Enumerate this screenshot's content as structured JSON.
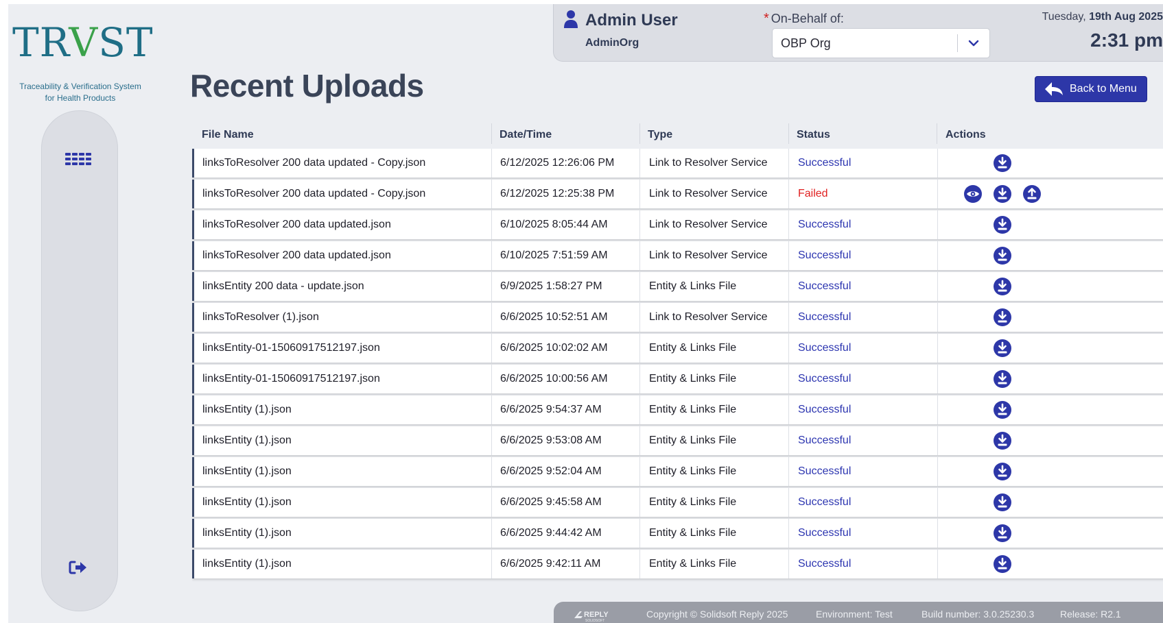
{
  "logo": {
    "name": "TRVST",
    "part1": "TR",
    "part2": "V",
    "part3": "ST",
    "tagline_line1": "Traceability & Verification System",
    "tagline_line2": "for Health Products"
  },
  "header": {
    "user_name": "Admin User",
    "user_org": "AdminOrg",
    "on_behalf_required": "*",
    "on_behalf_label": "On-Behalf of:",
    "on_behalf_value": "OBP Org",
    "date_day": "Tuesday,",
    "date_bold": "19th Aug 2025",
    "time": "2:31 pm"
  },
  "page": {
    "title": "Recent Uploads",
    "back_button": "Back to Menu"
  },
  "table": {
    "columns": [
      "File Name",
      "Date/Time",
      "Type",
      "Status",
      "Actions"
    ],
    "rows": [
      {
        "file": "linksToResolver 200 data updated - Copy.json",
        "datetime": "6/12/2025 12:26:06 PM",
        "type": "Link to Resolver Service",
        "status": "Successful",
        "actions": [
          "download"
        ]
      },
      {
        "file": "linksToResolver 200 data updated - Copy.json",
        "datetime": "6/12/2025 12:25:38 PM",
        "type": "Link to Resolver Service",
        "status": "Failed",
        "actions": [
          "view",
          "download",
          "upload"
        ]
      },
      {
        "file": "linksToResolver 200 data updated.json",
        "datetime": "6/10/2025 8:05:44 AM",
        "type": "Link to Resolver Service",
        "status": "Successful",
        "actions": [
          "download"
        ]
      },
      {
        "file": "linksToResolver 200 data updated.json",
        "datetime": "6/10/2025 7:51:59 AM",
        "type": "Link to Resolver Service",
        "status": "Successful",
        "actions": [
          "download"
        ]
      },
      {
        "file": "linksEntity 200 data - update.json",
        "datetime": "6/9/2025 1:58:27 PM",
        "type": "Entity & Links File",
        "status": "Successful",
        "actions": [
          "download"
        ]
      },
      {
        "file": "linksToResolver (1).json",
        "datetime": "6/6/2025 10:52:51 AM",
        "type": "Link to Resolver Service",
        "status": "Successful",
        "actions": [
          "download"
        ]
      },
      {
        "file": "linksEntity-01-15060917512197.json",
        "datetime": "6/6/2025 10:02:02 AM",
        "type": "Entity & Links File",
        "status": "Successful",
        "actions": [
          "download"
        ]
      },
      {
        "file": "linksEntity-01-15060917512197.json",
        "datetime": "6/6/2025 10:00:56 AM",
        "type": "Entity & Links File",
        "status": "Successful",
        "actions": [
          "download"
        ]
      },
      {
        "file": "linksEntity (1).json",
        "datetime": "6/6/2025 9:54:37 AM",
        "type": "Entity & Links File",
        "status": "Successful",
        "actions": [
          "download"
        ]
      },
      {
        "file": "linksEntity (1).json",
        "datetime": "6/6/2025 9:53:08 AM",
        "type": "Entity & Links File",
        "status": "Successful",
        "actions": [
          "download"
        ]
      },
      {
        "file": "linksEntity (1).json",
        "datetime": "6/6/2025 9:52:04 AM",
        "type": "Entity & Links File",
        "status": "Successful",
        "actions": [
          "download"
        ]
      },
      {
        "file": "linksEntity (1).json",
        "datetime": "6/6/2025 9:45:58 AM",
        "type": "Entity & Links File",
        "status": "Successful",
        "actions": [
          "download"
        ]
      },
      {
        "file": "linksEntity (1).json",
        "datetime": "6/6/2025 9:44:42 AM",
        "type": "Entity & Links File",
        "status": "Successful",
        "actions": [
          "download"
        ]
      },
      {
        "file": "linksEntity (1).json",
        "datetime": "6/6/2025 9:42:11 AM",
        "type": "Entity & Links File",
        "status": "Successful",
        "actions": [
          "download"
        ]
      }
    ]
  },
  "footer": {
    "brand": "REPLY",
    "brand_sub": "SOLIDSOFT",
    "copyright": "Copyright © Solidsoft Reply 2025",
    "environment": "Environment: Test",
    "build": "Build number: 3.0.25230.3",
    "release": "Release: R2.1"
  },
  "colors": {
    "accent": "#2d37a8",
    "success": "#2c35b0",
    "failed": "#e02020",
    "logo_teal": "#1f6e86",
    "logo_green": "#3aa14a"
  },
  "icons": {
    "menu": "grid-menu-icon",
    "logout": "logout-icon",
    "user": "user-icon",
    "chevron": "chevron-down-icon",
    "back": "back-arrow-icon",
    "view": "eye-icon",
    "download": "download-icon",
    "upload": "upload-icon"
  }
}
